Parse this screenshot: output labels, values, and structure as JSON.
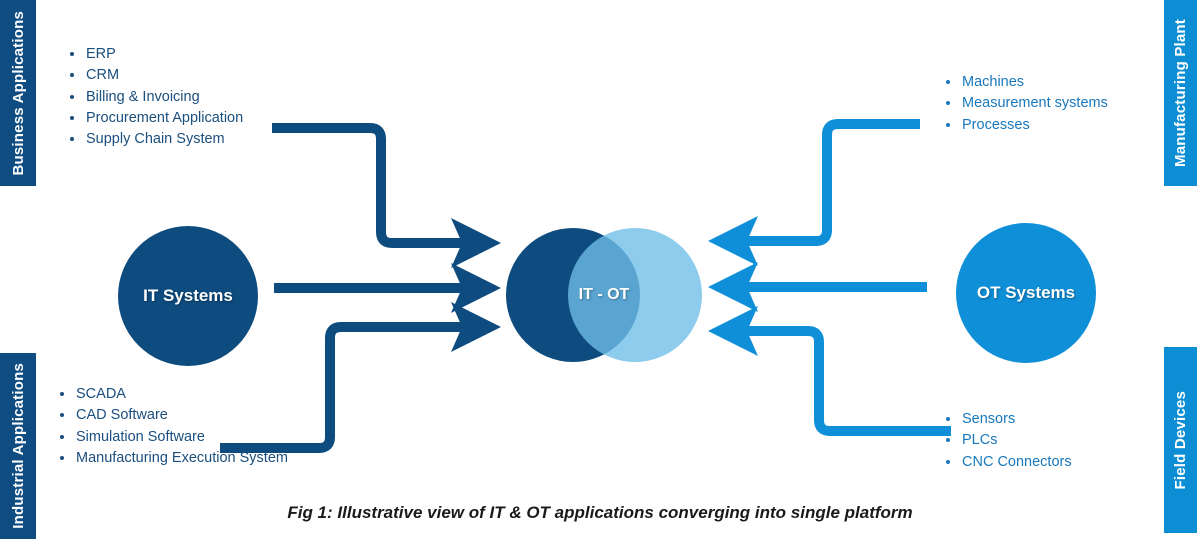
{
  "colors": {
    "dark_blue": "#0e4c80",
    "light_blue": "#0f8fd8",
    "venn_overlap": "#1b7bb5",
    "text_dark": "#1b4f7e",
    "text_light": "#1878bd",
    "caption": "#1a1a1a",
    "background": "#ffffff"
  },
  "sidebars": {
    "business": {
      "label": "Business Applications"
    },
    "industrial": {
      "label": "Industrial Applications"
    },
    "manufacturing": {
      "label": "Manufacturing Plant"
    },
    "field": {
      "label": "Field Devices"
    }
  },
  "lists": {
    "business": [
      "ERP",
      "CRM",
      "Billing & Invoicing",
      "Procurement Application",
      "Supply Chain System"
    ],
    "industrial": [
      "SCADA",
      "CAD Software",
      "Simulation Software",
      "Manufacturing Execution System"
    ],
    "manufacturing": [
      "Machines",
      "Measurement systems",
      "Processes"
    ],
    "field": [
      "Sensors",
      "PLCs",
      "CNC Connectors"
    ]
  },
  "nodes": {
    "it_systems": {
      "label": "IT Systems"
    },
    "ot_systems": {
      "label": "OT Systems"
    },
    "venn": {
      "label": "IT - OT"
    }
  },
  "caption": {
    "text": "Fig 1: Illustrative view of IT & OT applications converging into single platform"
  }
}
